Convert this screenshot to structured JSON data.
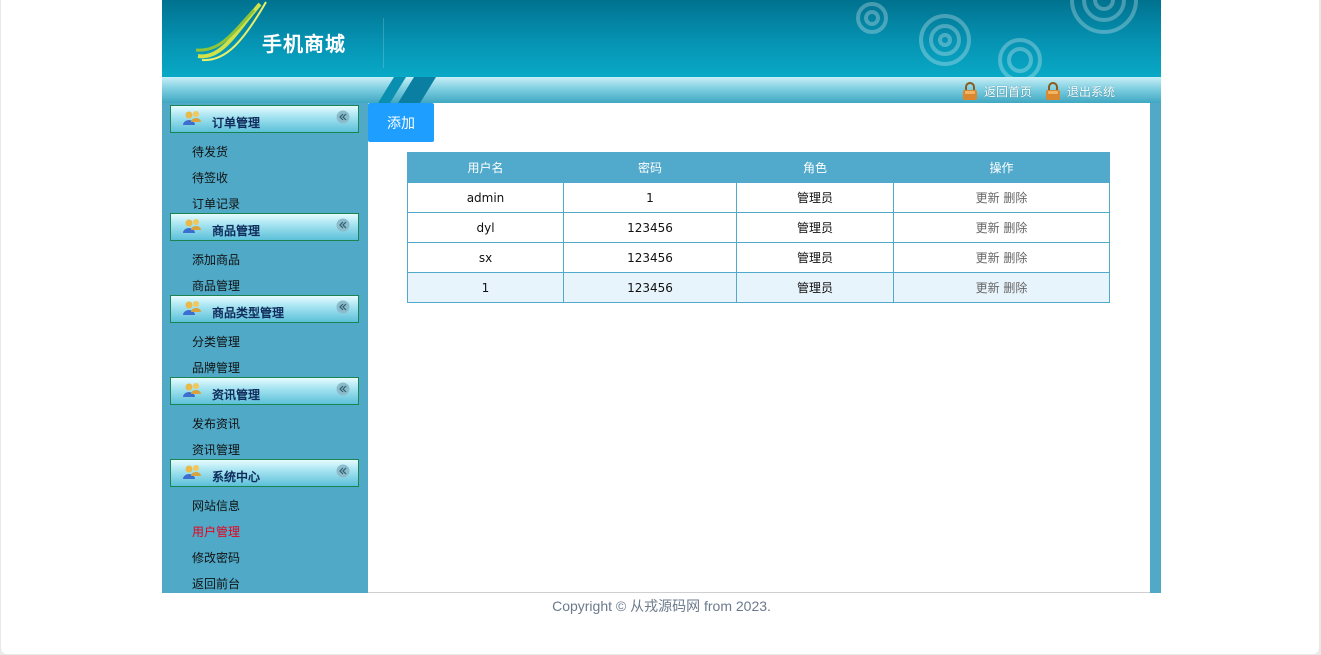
{
  "header": {
    "logo_text": "手机商城",
    "links": [
      {
        "label": "返回首页",
        "icon": "lock-icon"
      },
      {
        "label": "退出系统",
        "icon": "lock-icon"
      }
    ]
  },
  "sidebar": {
    "groups": [
      {
        "label": "订单管理",
        "items": [
          "待发货",
          "待签收",
          "订单记录"
        ]
      },
      {
        "label": "商品管理",
        "items": [
          "添加商品",
          "商品管理"
        ]
      },
      {
        "label": "商品类型管理",
        "items": [
          "分类管理",
          "品牌管理"
        ]
      },
      {
        "label": "资讯管理",
        "items": [
          "发布资讯",
          "资讯管理"
        ]
      },
      {
        "label": "系统中心",
        "items": [
          "网站信息",
          "用户管理",
          "修改密码",
          "返回前台"
        ]
      }
    ],
    "active_item": "用户管理"
  },
  "main": {
    "add_button": "添加",
    "table": {
      "columns": [
        "用户名",
        "密码",
        "角色",
        "操作"
      ],
      "rows": [
        {
          "username": "admin",
          "password": "1",
          "role": "管理员"
        },
        {
          "username": "dyl",
          "password": "123456",
          "role": "管理员"
        },
        {
          "username": "sx",
          "password": "123456",
          "role": "管理员"
        },
        {
          "username": "1",
          "password": "123456",
          "role": "管理员"
        }
      ],
      "update_label": "更新",
      "delete_label": "删除"
    }
  },
  "footer": {
    "copyright": "Copyright © 从戎源码网 from 2023."
  },
  "colors": {
    "header": "#0693b3",
    "sidebar": "#4fa9c7",
    "table_header": "#51a9cb",
    "add_button": "#1e9fff",
    "active_item": "#e8001c"
  }
}
